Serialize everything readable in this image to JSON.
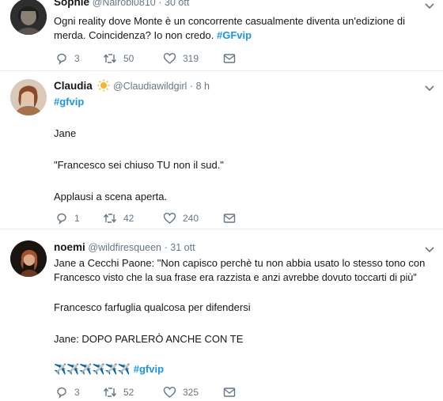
{
  "tweets": [
    {
      "name": "Sophie",
      "handle": "@Nairobi0810",
      "time": "30 ott",
      "lines": [
        "Ogni reality dove Monte è un concorrente casualmente diventa un'edizione di",
        "merda. Coincidenza? Io non credo."
      ],
      "hashtag": "#GFvip",
      "replies": "3",
      "retweets": "50",
      "likes": "319"
    },
    {
      "name": "Claudia",
      "handle": "@Claudiawildgirl",
      "time": "8 h",
      "hashtag": "#gfvip",
      "lines": [
        "Jane",
        "\"Francesco sei chiuso TU non il sud.\"",
        "Applausi a scena aperta."
      ],
      "replies": "1",
      "retweets": "42",
      "likes": "240"
    },
    {
      "name": "noemi",
      "handle": "@wildfiresqueen",
      "time": "31 ott",
      "lines": [
        "Jane a Cecchi Paone: \"Non capisco perchè tu non abbia usato lo stesso tono con",
        "Francesco visto che la sua frase era razzista e anzi avrebbe dovuto toccarti di più\"",
        "Francesco farfuglia qualcosa per difendersi",
        "Jane: DOPO PARLERÒ ANCHE CON TE"
      ],
      "emoji": "✈️✈️✈️✈️✈️✈️",
      "hashtag": "#gfvip",
      "replies": "3",
      "retweets": "52",
      "likes": "325"
    }
  ]
}
